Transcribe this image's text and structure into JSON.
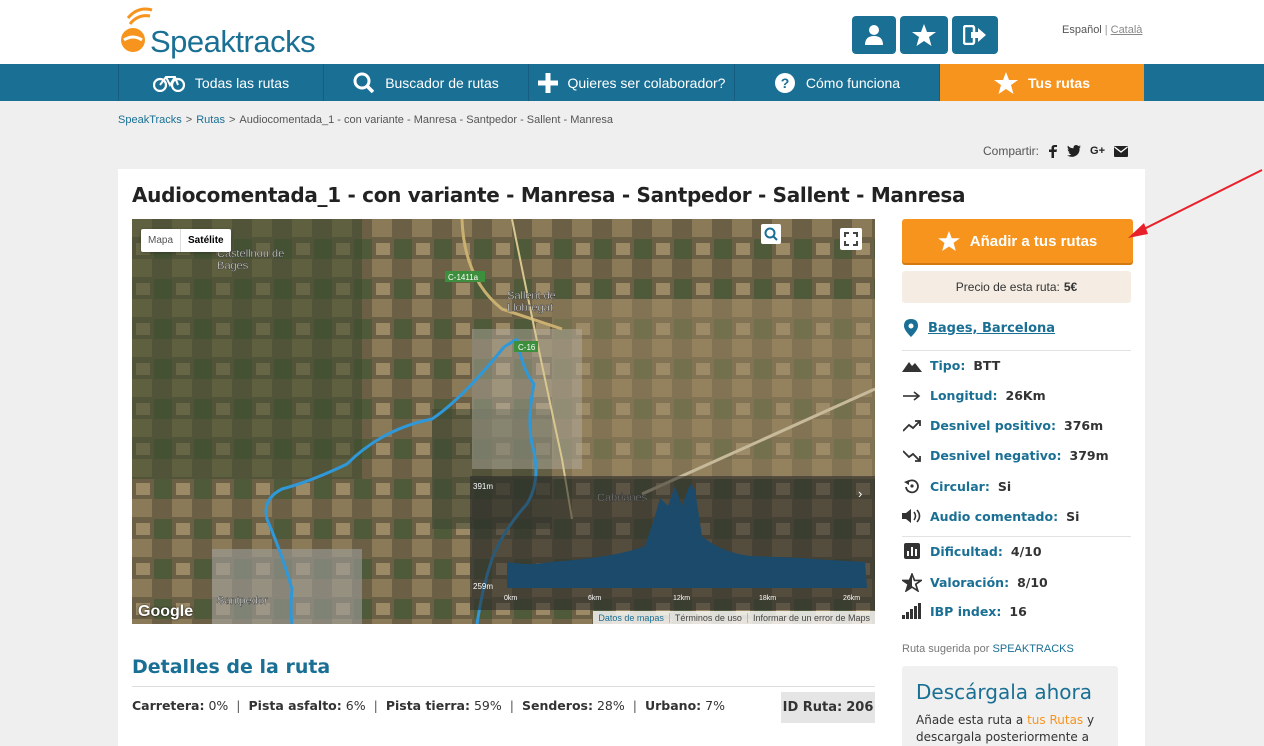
{
  "brand": {
    "name": "Speaktracks"
  },
  "header": {
    "buttons": [
      "user-icon",
      "star-icon",
      "logout-icon"
    ],
    "lang_es": "Español",
    "lang_sep": "|",
    "lang_ca": "Català"
  },
  "nav": [
    {
      "label": "Todas las rutas",
      "icon": "bike-icon"
    },
    {
      "label": "Buscador de rutas",
      "icon": "search-icon"
    },
    {
      "label": "Quieres ser colaborador?",
      "icon": "plus-icon"
    },
    {
      "label": "Cómo funciona",
      "icon": "question-icon"
    },
    {
      "label": "Tus rutas",
      "icon": "star-icon"
    }
  ],
  "breadcrumb": {
    "root": "SpeakTracks",
    "sep": ">",
    "section": "Rutas",
    "current": "Audiocomentada_1 - con variante - Manresa - Santpedor - Sallent - Manresa"
  },
  "share": {
    "label": "Compartir:",
    "networks": [
      "facebook-icon",
      "twitter-icon",
      "google-plus-icon",
      "email-icon"
    ]
  },
  "route": {
    "title": "Audiocomentada_1 - con variante - Manresa - Santpedor - Sallent - Manresa",
    "location": "Bages, Barcelona",
    "add_button": "Añadir a tus rutas",
    "price_label": "Precio de esta ruta:",
    "price_value": "5€",
    "attributes": [
      {
        "label": "Tipo:",
        "value": "BTT",
        "icon": "mountain-icon"
      },
      {
        "label": "Longitud:",
        "value": "26Km",
        "icon": "arrow-right-icon"
      },
      {
        "label": "Desnivel positivo:",
        "value": "376m",
        "icon": "trend-up-icon"
      },
      {
        "label": "Desnivel negativo:",
        "value": "379m",
        "icon": "trend-down-icon"
      },
      {
        "label": "Circular:",
        "value": "Si",
        "icon": "circular-icon"
      },
      {
        "label": "Audio comentado:",
        "value": "Si",
        "icon": "speaker-icon"
      },
      {
        "label": "Dificultad:",
        "value": "4/10",
        "icon": "bar-chart-icon"
      },
      {
        "label": "Valoración:",
        "value": "8/10",
        "icon": "star-outline-icon"
      },
      {
        "label": "IBP index:",
        "value": "16",
        "icon": "signal-icon"
      }
    ],
    "suggested_label": "Ruta sugerida por",
    "suggested_by": "SPEAKTRACKS"
  },
  "map": {
    "type_map": "Mapa",
    "type_satellite": "Satélite",
    "google": "Google",
    "footer": [
      "Datos de mapas",
      "Términos de uso",
      "Informar de un error de Maps"
    ]
  },
  "details": {
    "title": "Detalles de la ruta",
    "items": [
      {
        "k": "Carretera:",
        "v": "0%"
      },
      {
        "k": "Pista asfalto:",
        "v": "6%"
      },
      {
        "k": "Pista tierra:",
        "v": "59%"
      },
      {
        "k": "Senderos:",
        "v": "28%"
      },
      {
        "k": "Urbano:",
        "v": "7%"
      }
    ],
    "id_label": "ID Ruta:",
    "id_value": "206"
  },
  "download": {
    "title": "Descárgala ahora",
    "text_a": "Añade esta ruta a",
    "text_link": "tus Rutas",
    "text_b": "y descargala posteriormente a tu"
  },
  "colors": {
    "primary": "#1a6f94",
    "accent": "#f7941d"
  }
}
